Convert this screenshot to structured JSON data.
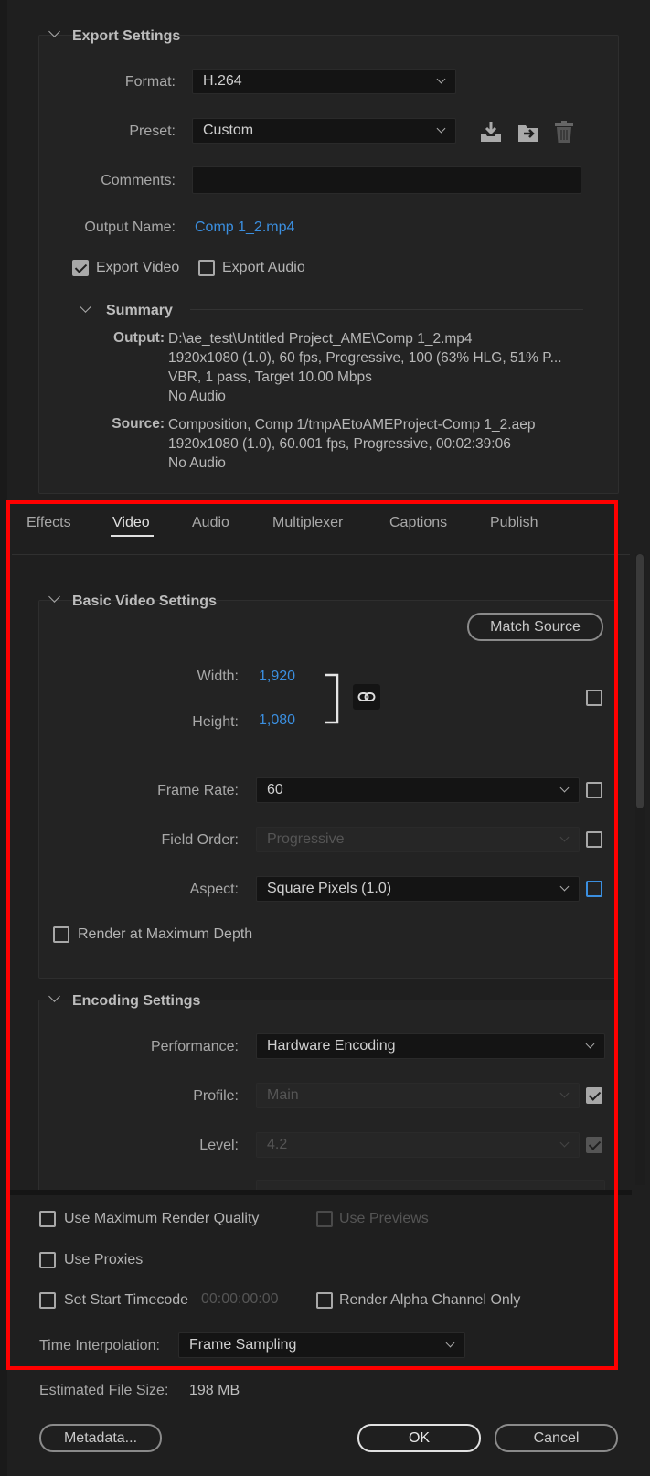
{
  "export_settings": {
    "title": "Export Settings",
    "format_label": "Format:",
    "format_value": "H.264",
    "preset_label": "Preset:",
    "preset_value": "Custom",
    "comments_label": "Comments:",
    "comments_value": "",
    "output_name_label": "Output Name:",
    "output_name_value": "Comp 1_2.mp4",
    "export_video_label": "Export Video",
    "export_video_checked": true,
    "export_audio_label": "Export Audio",
    "export_audio_checked": false
  },
  "summary": {
    "title": "Summary",
    "output_key": "Output:",
    "output_lines": [
      "D:\\ae_test\\Untitled Project_AME\\Comp 1_2.mp4",
      "1920x1080 (1.0), 60 fps, Progressive, 100 (63% HLG, 51% P...",
      "VBR, 1 pass, Target 10.00 Mbps",
      "No Audio"
    ],
    "source_key": "Source:",
    "source_lines": [
      "Composition, Comp 1/tmpAEtoAMEProject-Comp 1_2.aep",
      "1920x1080 (1.0), 60.001 fps, Progressive, 00:02:39:06",
      "No Audio"
    ]
  },
  "tabs": [
    {
      "label": "Effects",
      "active": false
    },
    {
      "label": "Video",
      "active": true
    },
    {
      "label": "Audio",
      "active": false
    },
    {
      "label": "Multiplexer",
      "active": false
    },
    {
      "label": "Captions",
      "active": false
    },
    {
      "label": "Publish",
      "active": false
    }
  ],
  "basic_video": {
    "title": "Basic Video Settings",
    "match_source_label": "Match Source",
    "width_label": "Width:",
    "width_value": "1,920",
    "height_label": "Height:",
    "height_value": "1,080",
    "frame_rate_label": "Frame Rate:",
    "frame_rate_value": "60",
    "field_order_label": "Field Order:",
    "field_order_value": "Progressive",
    "aspect_label": "Aspect:",
    "aspect_value": "Square Pixels (1.0)",
    "render_max_depth_label": "Render at Maximum Depth"
  },
  "encoding": {
    "title": "Encoding Settings",
    "performance_label": "Performance:",
    "performance_value": "Hardware Encoding",
    "profile_label": "Profile:",
    "profile_value": "Main",
    "level_label": "Level:",
    "level_value": "4.2"
  },
  "bottom": {
    "max_render_quality_label": "Use Maximum Render Quality",
    "use_previews_label": "Use Previews",
    "use_proxies_label": "Use Proxies",
    "set_start_timecode_label": "Set Start Timecode",
    "start_timecode_value": "00:00:00:00",
    "render_alpha_label": "Render Alpha Channel Only",
    "time_interp_label": "Time Interpolation:",
    "time_interp_value": "Frame Sampling",
    "est_size_label": "Estimated File Size:",
    "est_size_value": "198 MB"
  },
  "buttons": {
    "metadata": "Metadata...",
    "ok": "OK",
    "cancel": "Cancel"
  },
  "colors": {
    "background": "#1f1f1f",
    "link": "#3b8fe0",
    "highlight_box": "#ff0000"
  }
}
